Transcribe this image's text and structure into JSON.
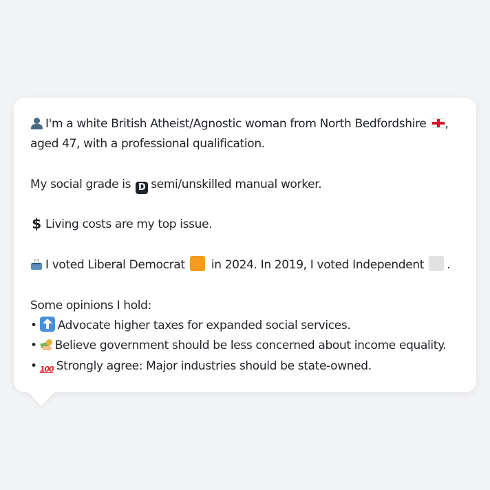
{
  "profile": {
    "intro_line1": "I'm a white British Atheist/Agnostic woman from North Bedfordshire",
    "intro_line1_end": ",",
    "intro_line2": "aged 47, with a professional qualification.",
    "social_grade_prefix": "My social grade is",
    "social_grade_letter": "D",
    "social_grade_suffix": "semi/unskilled manual worker.",
    "top_issue": "Living costs are my top issue.",
    "vote_prefix": "I voted Liberal Democrat",
    "vote_middle": "in 2024. In 2019, I voted Independent",
    "vote_end": ".",
    "opinions_heading": "Some opinions I hold:",
    "opinions": [
      {
        "bullet": "•",
        "icon": "up-arrow-icon",
        "text": "Advocate higher taxes for expanded social services."
      },
      {
        "bullet": "•",
        "icon": "money-hand-icon",
        "text": "Believe government should be less concerned about income equality."
      },
      {
        "bullet": "•",
        "icon": "hundred-icon",
        "text": "Strongly agree: Major industries should be state-owned."
      }
    ]
  },
  "icons": {
    "person": "person-icon",
    "flag": "england-flag-icon",
    "grade": "d-square-icon",
    "dollar": "dollar-icon",
    "dollar_glyph": "$",
    "ballot": "ballot-box-icon",
    "party_2024": "orange-square-icon",
    "party_2019": "grey-square-icon",
    "hundred_glyph": "100"
  },
  "colors": {
    "background": "#f3f4f6",
    "card": "#ffffff",
    "text": "#1f2328",
    "lib_dem_orange": "#f59a23",
    "independent_grey": "#e2e2e2"
  }
}
